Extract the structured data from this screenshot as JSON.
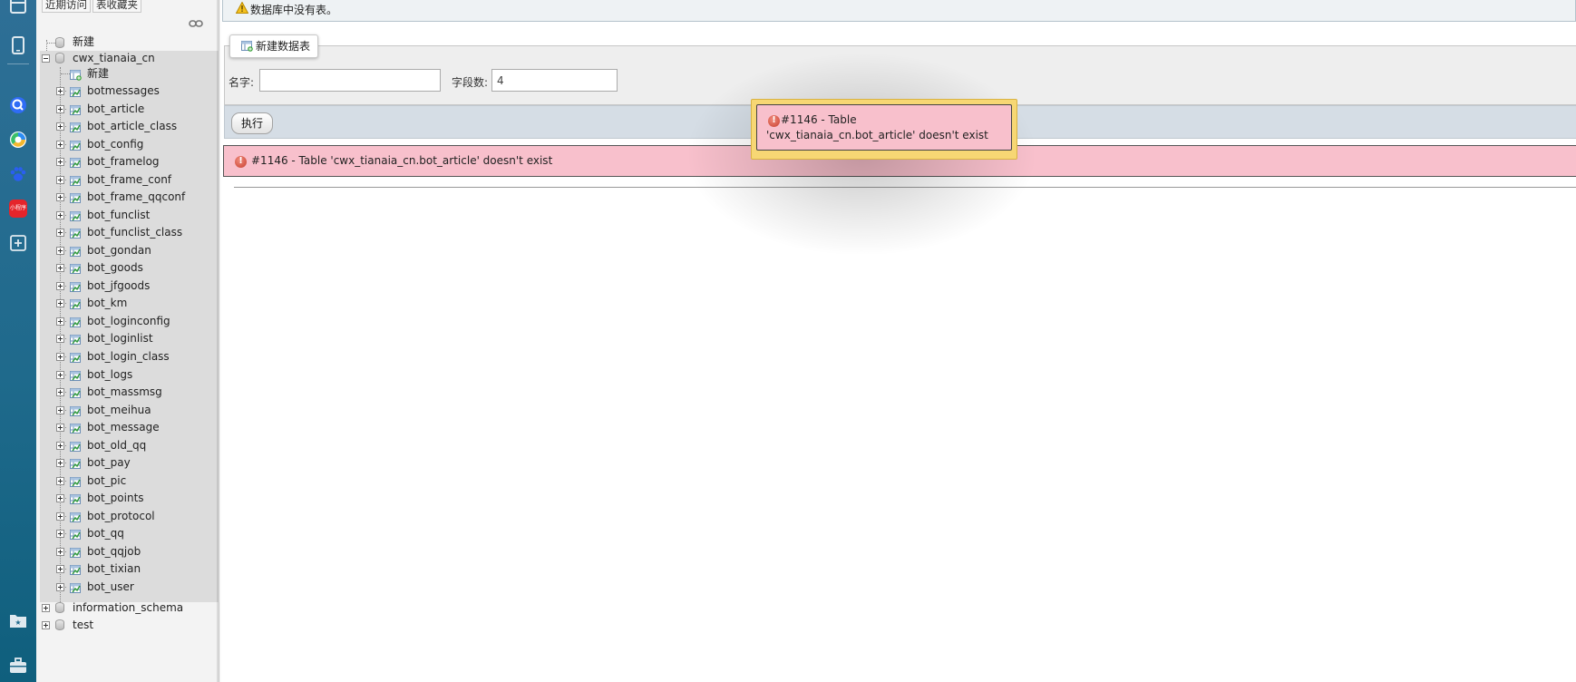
{
  "nav": {
    "recent_button": "近期访问",
    "favorites_button": "表收藏夹",
    "new_root": "新建",
    "databases": [
      {
        "name": "cwx_tianaia_cn",
        "expanded": true,
        "new_label": "新建",
        "tables": [
          "botmessages",
          "bot_article",
          "bot_article_class",
          "bot_config",
          "bot_framelog",
          "bot_frame_conf",
          "bot_frame_qqconf",
          "bot_funclist",
          "bot_funclist_class",
          "bot_gondan",
          "bot_goods",
          "bot_jfgoods",
          "bot_km",
          "bot_loginconfig",
          "bot_loginlist",
          "bot_login_class",
          "bot_logs",
          "bot_massmsg",
          "bot_meihua",
          "bot_message",
          "bot_old_qq",
          "bot_pay",
          "bot_pic",
          "bot_points",
          "bot_protocol",
          "bot_qq",
          "bot_qqjob",
          "bot_tixian",
          "bot_user"
        ]
      },
      {
        "name": "information_schema",
        "expanded": false
      },
      {
        "name": "test",
        "expanded": false
      }
    ]
  },
  "main": {
    "notice": "数据库中没有表。",
    "new_table_tab": "新建数据表",
    "name_label": "名字:",
    "name_value": "",
    "fields_label": "字段数:",
    "fields_value": "4",
    "execute_button": "执行",
    "error_message": "#1146 - Table 'cwx_tianaia_cn.bot_article' doesn't exist"
  },
  "popup": {
    "message": "#1146 - Table 'cwx_tianaia_cn.bot_article' doesn't exist"
  },
  "dock": {
    "icons": [
      "window-icon",
      "phone-icon",
      "search-app-icon",
      "browser-app-icon",
      "paw-app-icon",
      "mini-program-icon",
      "add-app-icon",
      "starred-folder-icon",
      "briefcase-icon"
    ],
    "mini_program_label": "小程序"
  },
  "colors": {
    "error_bg": "#f8c0cc",
    "popup_border": "#f7d774",
    "exec_bar": "#d5dde5",
    "dock": "#1f6a8c"
  }
}
